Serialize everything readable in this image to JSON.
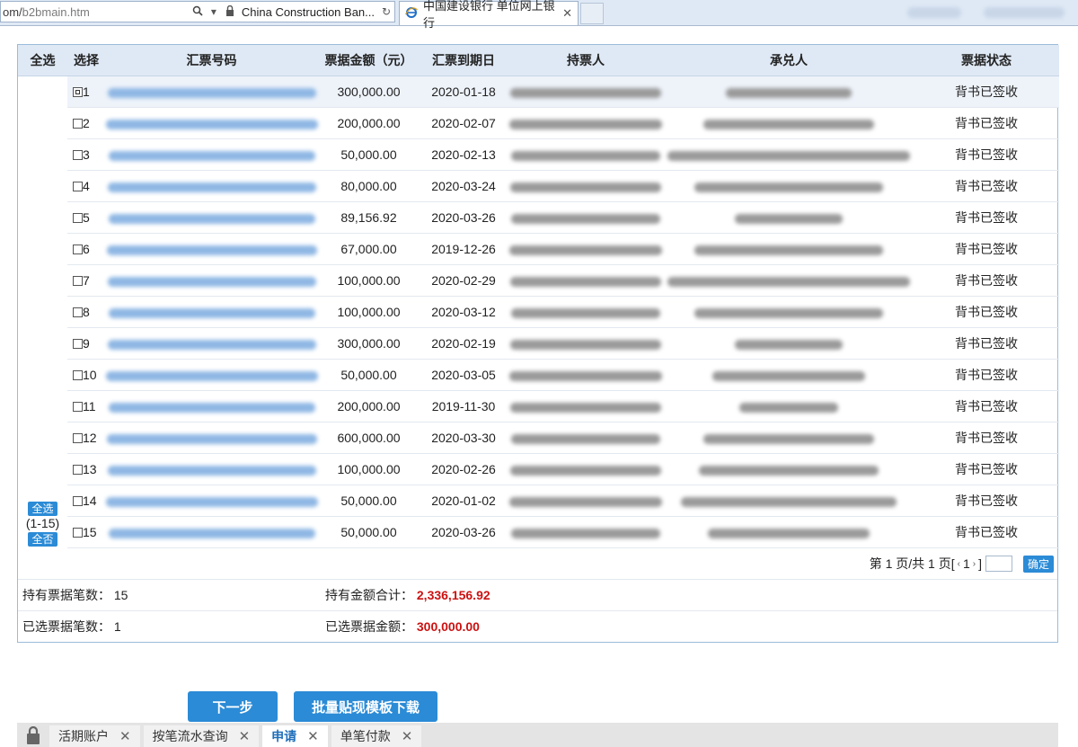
{
  "browser": {
    "address_prefix": "om/",
    "address_path": "b2bmain.htm",
    "site_identity": "China Construction Ban...",
    "active_tab_title": "中国建设银行 单位网上银行"
  },
  "table": {
    "headers": {
      "select_all": "全选",
      "select": "选择",
      "bill_no": "汇票号码",
      "amount": "票据金额（元）",
      "due_date": "汇票到期日",
      "holder": "持票人",
      "acceptor": "承兑人",
      "status": "票据状态"
    },
    "rows": [
      {
        "no": "1",
        "amount": "300,000.00",
        "due": "2020-01-18",
        "status": "背书已签收",
        "checked": true
      },
      {
        "no": "2",
        "amount": "200,000.00",
        "due": "2020-02-07",
        "status": "背书已签收",
        "checked": false
      },
      {
        "no": "3",
        "amount": "50,000.00",
        "due": "2020-02-13",
        "status": "背书已签收",
        "checked": false
      },
      {
        "no": "4",
        "amount": "80,000.00",
        "due": "2020-03-24",
        "status": "背书已签收",
        "checked": false
      },
      {
        "no": "5",
        "amount": "89,156.92",
        "due": "2020-03-26",
        "status": "背书已签收",
        "checked": false
      },
      {
        "no": "6",
        "amount": "67,000.00",
        "due": "2019-12-26",
        "status": "背书已签收",
        "checked": false
      },
      {
        "no": "7",
        "amount": "100,000.00",
        "due": "2020-02-29",
        "status": "背书已签收",
        "checked": false
      },
      {
        "no": "8",
        "amount": "100,000.00",
        "due": "2020-03-12",
        "status": "背书已签收",
        "checked": false
      },
      {
        "no": "9",
        "amount": "300,000.00",
        "due": "2020-02-19",
        "status": "背书已签收",
        "checked": false
      },
      {
        "no": "10",
        "amount": "50,000.00",
        "due": "2020-03-05",
        "status": "背书已签收",
        "checked": false
      },
      {
        "no": "11",
        "amount": "200,000.00",
        "due": "2019-11-30",
        "status": "背书已签收",
        "checked": false
      },
      {
        "no": "12",
        "amount": "600,000.00",
        "due": "2020-03-30",
        "status": "背书已签收",
        "checked": false
      },
      {
        "no": "13",
        "amount": "100,000.00",
        "due": "2020-02-26",
        "status": "背书已签收",
        "checked": false
      },
      {
        "no": "14",
        "amount": "50,000.00",
        "due": "2020-01-02",
        "status": "背书已签收",
        "checked": false
      },
      {
        "no": "15",
        "amount": "50,000.00",
        "due": "2020-03-26",
        "status": "背书已签收",
        "checked": false
      }
    ],
    "select_all_button": "全选",
    "select_range": "(1-15)",
    "select_none_button": "全否"
  },
  "pager": {
    "text": "第 1 页/共 1 页[",
    "prev": "‹",
    "current": "1",
    "next": "›",
    "close": "]",
    "confirm": "确定"
  },
  "summary": {
    "held_count_label": "持有票据笔数：",
    "held_count": "15",
    "held_total_label": "持有金额合计：",
    "held_total": "2,336,156.92",
    "selected_count_label": "已选票据笔数：",
    "selected_count": "1",
    "selected_total_label": "已选票据金额：",
    "selected_total": "300,000.00"
  },
  "actions": {
    "next_step": "下一步",
    "download_template": "批量贴现模板下载"
  },
  "taskbar": {
    "tabs": [
      {
        "label": "活期账户",
        "active": false
      },
      {
        "label": "按笔流水查询",
        "active": false
      },
      {
        "label": "申请",
        "active": true
      },
      {
        "label": "单笔付款",
        "active": false
      }
    ],
    "close_glyph": "✕"
  },
  "icons": {
    "search": "search-icon",
    "lock": "lock-icon",
    "refresh": "refresh-icon",
    "ie": "ie-icon",
    "close": "close-icon"
  },
  "colors": {
    "accent": "#2b8bd6",
    "header_bg": "#dfe9f5",
    "total_red": "#cc1111",
    "active_tab_text": "#1f6fba"
  }
}
